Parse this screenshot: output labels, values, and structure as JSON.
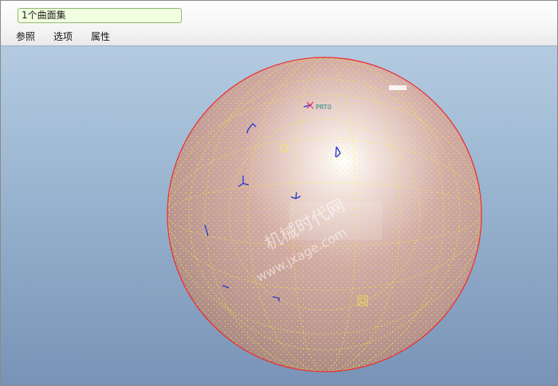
{
  "dashboard": {
    "collector_value": "1个曲面集",
    "tabs": [
      "参照",
      "选项",
      "属性"
    ]
  },
  "viewport": {
    "csys_label": "PRT0",
    "watermark": {
      "line1": "机械时代网",
      "line2": "www.jxage.com"
    }
  },
  "colors": {
    "surface_edge": "#ee2b2b",
    "mesh_points": "#ffff33",
    "datum_markers": "#2233cc"
  }
}
